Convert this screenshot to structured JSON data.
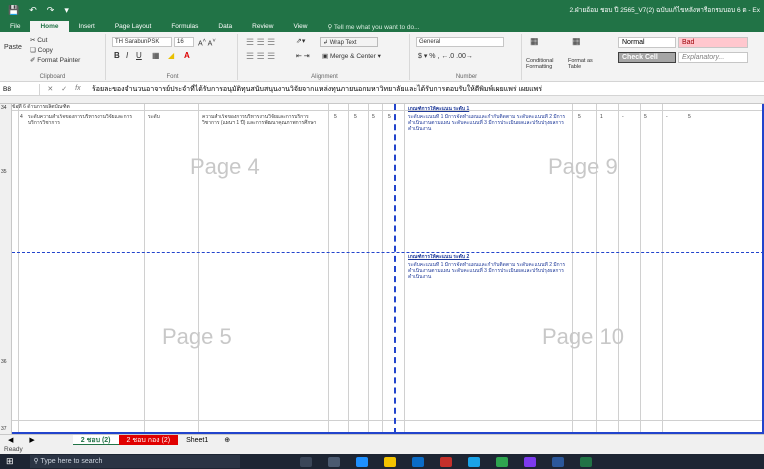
{
  "window": {
    "title": "2.ฝ่ายอ้อม ชอบ ปี 2565_V7(2) ฉบับแก้ไขหลังหารือกรมบอบ 6 ต - Ex"
  },
  "ribbon_tabs": [
    "File",
    "Home",
    "Insert",
    "Page Layout",
    "Formulas",
    "Data",
    "Review",
    "View"
  ],
  "tell_me": "Tell me what you want to do...",
  "clipboard": {
    "cut": "Cut",
    "copy": "Copy",
    "format_painter": "Format Painter",
    "paste": "Paste",
    "label": "Clipboard"
  },
  "font": {
    "name": "TH SarabunPSK",
    "size": "16",
    "label": "Font"
  },
  "alignment": {
    "wrap_text": "Wrap Text",
    "merge_center": "Merge & Center",
    "label": "Alignment"
  },
  "number": {
    "format": "General",
    "label": "Number"
  },
  "styles": {
    "conditional": "Conditional Formatting",
    "format_table": "Format as Table",
    "normal": "Normal",
    "bad": "Bad",
    "check_cell": "Check Cell",
    "explanatory": "Explanatory..."
  },
  "formula_bar": {
    "cell_ref": "B8",
    "content": "ร้อยละของจำนวนอาจารย์ประจำที่ได้รับการอนุมัติทุนสนับสนุนงานวิจัยจากแหล่งทุนภายนอกมหาวิทยาลัยและได้รับการตอบรับให้ตีพิมพ์เผยแพร่ เผยแพร่"
  },
  "row_numbers": [
    "34",
    "35",
    "36",
    "37"
  ],
  "pages": [
    "Page 4",
    "Page 9",
    "Page 5",
    "Page 10"
  ],
  "cells": {
    "section_header": "ข้อที่ 6 ด้านการผลิตบัณฑิต",
    "item_number": "4",
    "indicator": "ระดับความสำเร็จของการบริหารงานวิจัยและการบริการวิชาการ",
    "unit": "ระดับ",
    "description": "ความสำเร็จของการบริหารงานวิจัยและการบริการวิชาการ (แผนฯ 1 ปี) และการพัฒนาคุณภาพการศึกษา",
    "scores": [
      "5",
      "5",
      "5",
      "5",
      "5"
    ],
    "criteria_title_1": "เกณฑ์การให้คะแนน ระดับ 1",
    "criteria_title_2": "เกณฑ์การให้คะแนน ระดับ 2",
    "criteria_body": "ระดับคะแนนที่ 1 มีการจัดทำแผนและกำกับติดตาม ระดับคะแนนที่ 2 มีการดำเนินงานตามแผน ระดับคะแนนที่ 3 มีการประเมินผลและปรับปรุงผลการดำเนินงาน",
    "right_vals": [
      "5",
      "1",
      "-",
      "5",
      "-",
      "5"
    ]
  },
  "sheet_tabs": [
    "2 ชอบ (2)",
    "2 ชอบ กอง (2)",
    "Sheet1"
  ],
  "status": "Ready",
  "taskbar": {
    "search_placeholder": "Type here to search"
  },
  "colors": {
    "excel_green": "#217346",
    "page_break": "#2244cc",
    "active_tab_red": "#e00000"
  }
}
